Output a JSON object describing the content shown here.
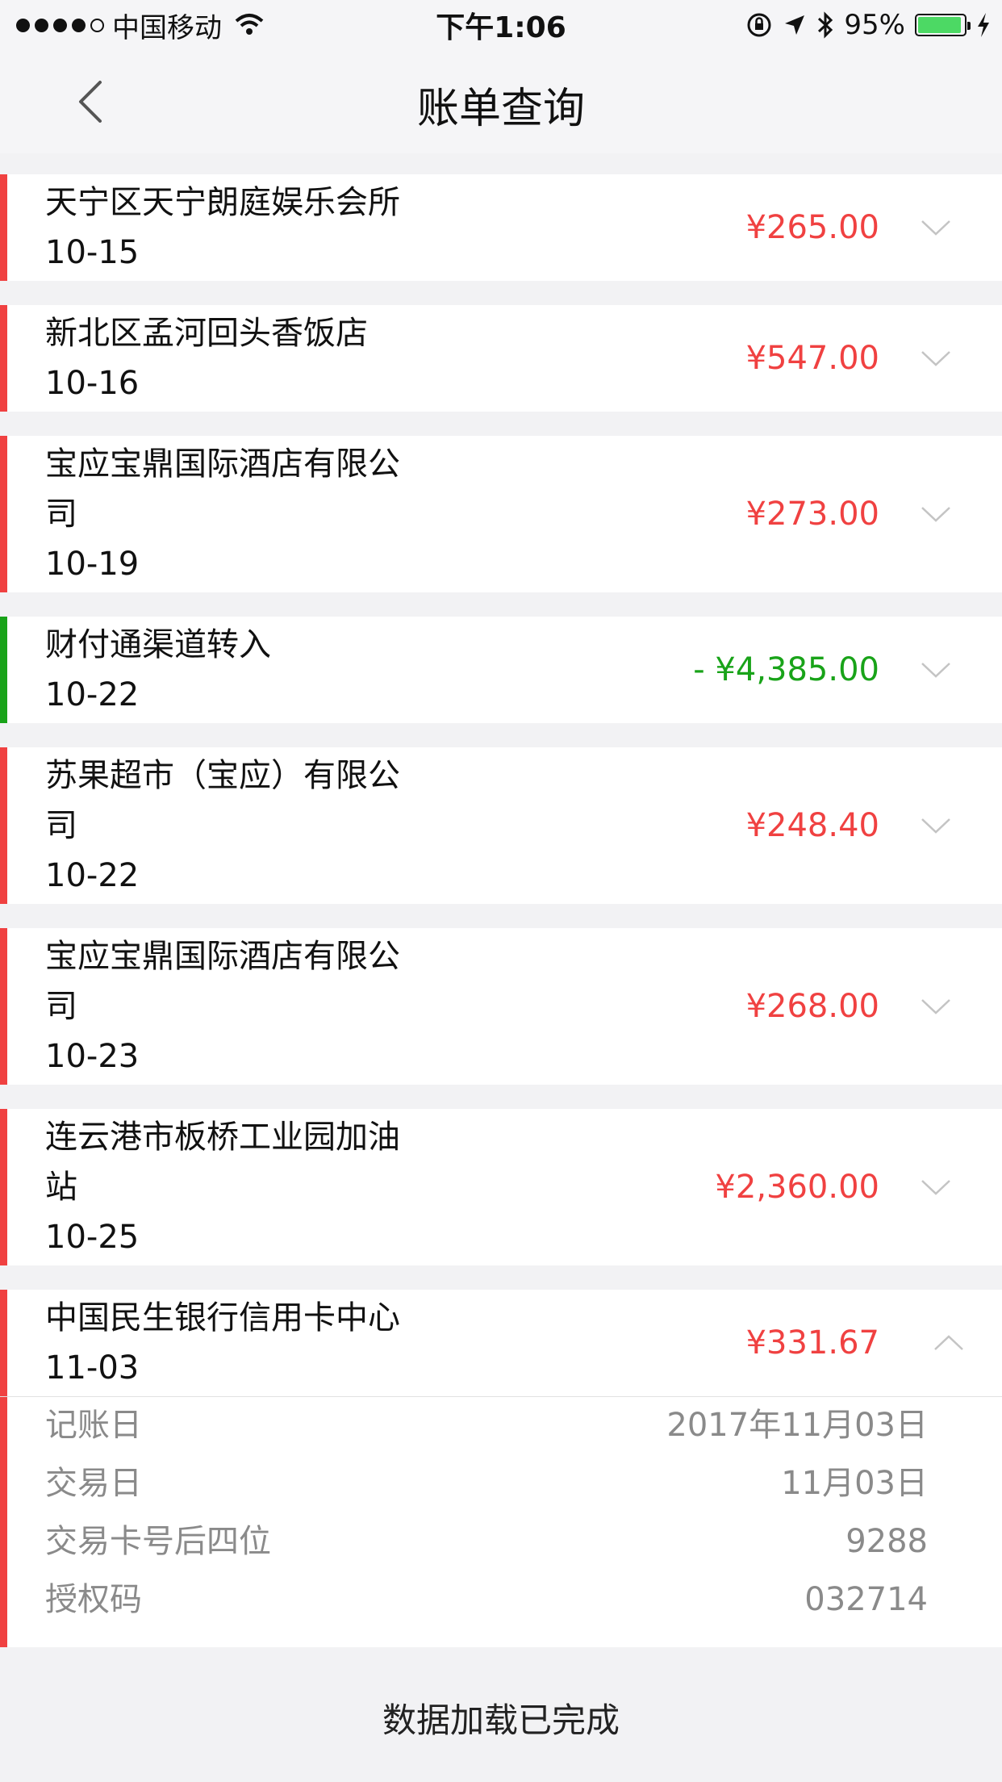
{
  "status_bar": {
    "carrier": "中国移动",
    "time": "下午1:06",
    "battery_percent": "95%",
    "battery_level": 0.95
  },
  "nav": {
    "title": "账单查询"
  },
  "colors": {
    "expense": "#f04141",
    "income": "#19a319",
    "detail_text": "#8a8a8a"
  },
  "transactions": [
    {
      "name_lines": [
        "天宁区天宁朗庭娱乐会所"
      ],
      "date": "10-15",
      "amount": "¥265.00",
      "type": "expense",
      "expanded": false
    },
    {
      "name_lines": [
        "新北区孟河回头香饭店"
      ],
      "date": "10-16",
      "amount": "¥547.00",
      "type": "expense",
      "expanded": false
    },
    {
      "name_lines": [
        "宝应宝鼎国际酒店有限公",
        "司"
      ],
      "date": "10-19",
      "amount": "¥273.00",
      "type": "expense",
      "expanded": false
    },
    {
      "name_lines": [
        "财付通渠道转入"
      ],
      "date": "10-22",
      "amount": "- ¥4,385.00",
      "type": "income",
      "expanded": false
    },
    {
      "name_lines": [
        "苏果超市（宝应）有限公",
        "司"
      ],
      "date": "10-22",
      "amount": "¥248.40",
      "type": "expense",
      "expanded": false
    },
    {
      "name_lines": [
        "宝应宝鼎国际酒店有限公",
        "司"
      ],
      "date": "10-23",
      "amount": "¥268.00",
      "type": "expense",
      "expanded": false
    },
    {
      "name_lines": [
        "连云港市板桥工业园加油",
        "站"
      ],
      "date": "10-25",
      "amount": "¥2,360.00",
      "type": "expense",
      "expanded": false
    },
    {
      "name_lines": [
        "中国民生银行信用卡中心"
      ],
      "date": "11-03",
      "amount": "¥331.67",
      "type": "expense",
      "expanded": true,
      "details": [
        {
          "label": "记账日",
          "value": "2017年11月03日"
        },
        {
          "label": "交易日",
          "value": "11月03日"
        },
        {
          "label": "交易卡号后四位",
          "value": "9288"
        },
        {
          "label": "授权码",
          "value": "032714"
        }
      ]
    }
  ],
  "footer": {
    "message": "数据加载已完成"
  }
}
